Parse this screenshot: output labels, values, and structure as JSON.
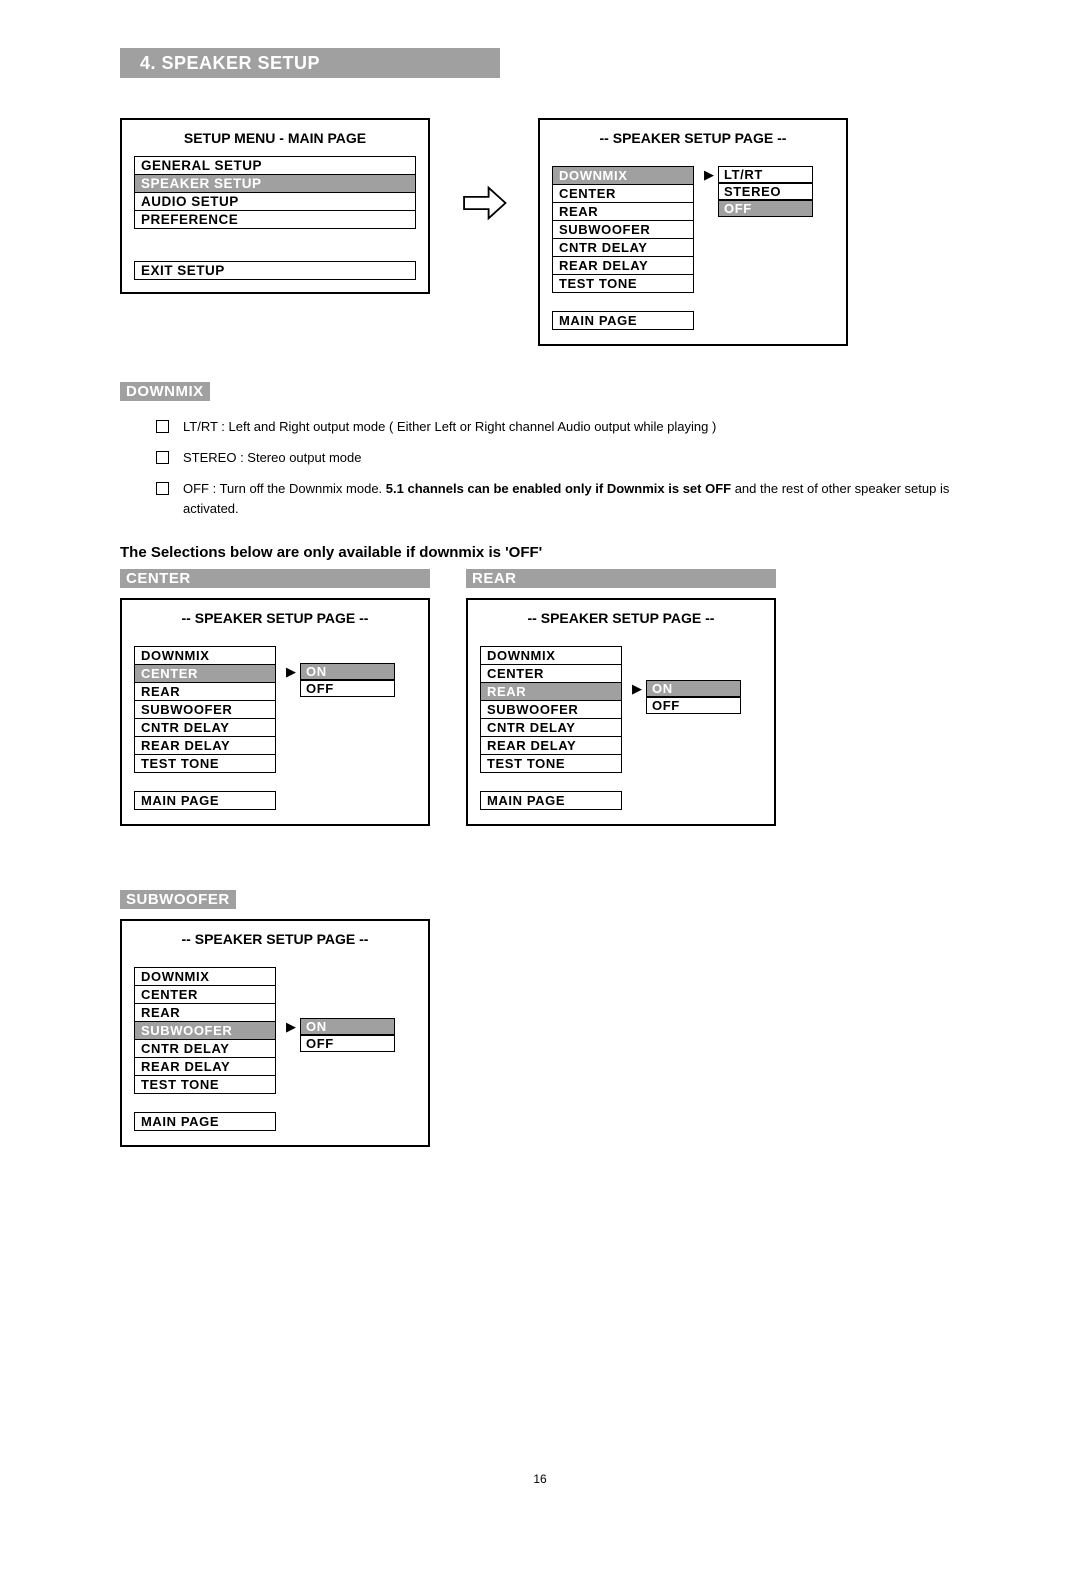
{
  "title": "4.  SPEAKER   SETUP",
  "setup_menu": {
    "title": "SETUP MENU     -     MAIN PAGE",
    "items": [
      "GENERAL SETUP",
      "SPEAKER SETUP",
      "AUDIO SETUP",
      "PREFERENCE"
    ],
    "selected": 1,
    "exit": "EXIT SETUP"
  },
  "speaker_page_title": "-- SPEAKER SETUP PAGE --",
  "speaker_items": [
    "DOWNMIX",
    "CENTER",
    "REAR",
    "SUBWOOFER",
    "CNTR DELAY",
    "REAR DELAY",
    "TEST TONE"
  ],
  "main_page": "MAIN PAGE",
  "downmix": {
    "label": "DOWNMIX",
    "options": [
      "LT/RT",
      "STEREO",
      "OFF"
    ],
    "selected": 2,
    "menu_selected": 0,
    "bullets": [
      {
        "pre": "LT/RT : Left and Right output mode ( Either Left or Right channel Audio output while playing )"
      },
      {
        "pre": "STEREO : Stereo output mode"
      },
      {
        "pre": "OFF : Turn off the Downmix mode.   ",
        "bold": "5.1 channels can be enabled only if Downmix is set OFF",
        "post": " and the rest of other speaker setup is activated."
      }
    ]
  },
  "note": "The Selections below are only available if downmix is 'OFF'",
  "center": {
    "label": "CENTER",
    "options": [
      "ON",
      "OFF"
    ],
    "selected": 0,
    "menu_selected": 1
  },
  "rear": {
    "label": "REAR",
    "options": [
      "ON",
      "OFF"
    ],
    "selected": 0,
    "menu_selected": 2
  },
  "subwoofer": {
    "label": "SUBWOOFER",
    "options": [
      "ON",
      "OFF"
    ],
    "selected": 0,
    "menu_selected": 3
  },
  "pgnum": "16"
}
